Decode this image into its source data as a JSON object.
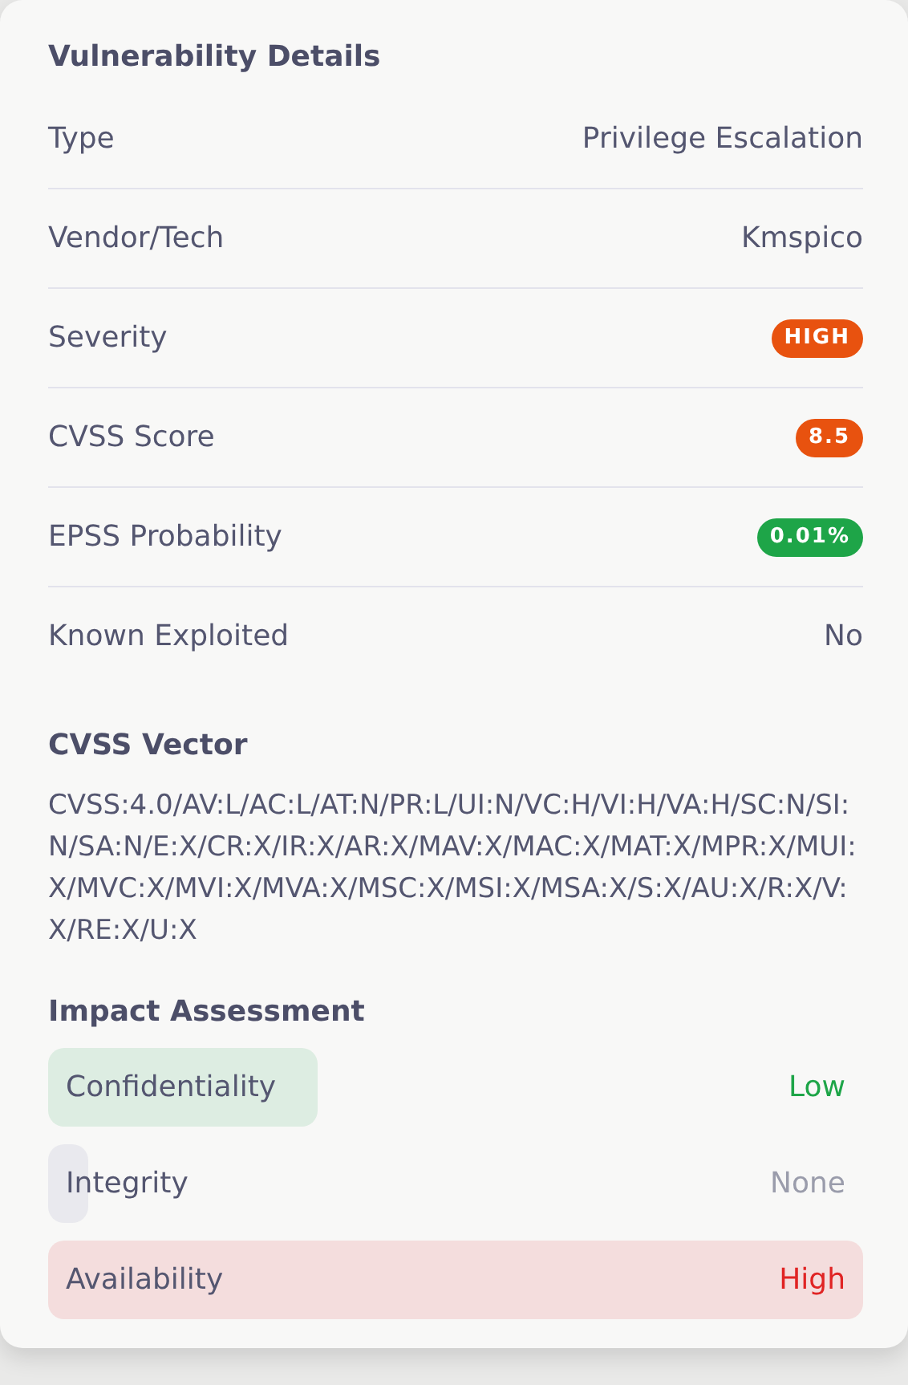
{
  "details": {
    "title": "Vulnerability Details",
    "rows": [
      {
        "label": "Type",
        "kind": "text",
        "value": "Privilege Escalation"
      },
      {
        "label": "Vendor/Tech",
        "kind": "text",
        "value": "Kmspico"
      },
      {
        "label": "Severity",
        "kind": "badge",
        "value": "HIGH",
        "color": "#e8520f"
      },
      {
        "label": "CVSS Score",
        "kind": "badge",
        "value": "8.5",
        "color": "#e8520f"
      },
      {
        "label": "EPSS Probability",
        "kind": "badge",
        "value": "0.01%",
        "color": "#1ea548"
      },
      {
        "label": "Known Exploited",
        "kind": "text",
        "value": "No"
      }
    ]
  },
  "vector": {
    "title": "CVSS Vector",
    "text": "CVSS:4.0/AV:L/AC:L/AT:N/PR:L/UI:N/VC:H/VI:H/VA:H/SC:N/SI:N/SA:N/E:X/CR:X/IR:X/AR:X/MAV:X/MAC:X/MAT:X/MPR:X/MUI:X/MVC:X/MVI:X/MVA:X/MSC:X/MSI:X/MSA:X/S:X/AU:X/R:X/V:X/RE:X/U:X"
  },
  "impact": {
    "title": "Impact Assessment",
    "rows": [
      {
        "label": "Confidentiality",
        "value": "Low",
        "kind": "low",
        "color": "#1ea548"
      },
      {
        "label": "Integrity",
        "value": "None",
        "kind": "none",
        "color": "#9a9cab"
      },
      {
        "label": "Availability",
        "value": "High",
        "kind": "high",
        "color": "#e02424"
      }
    ]
  }
}
